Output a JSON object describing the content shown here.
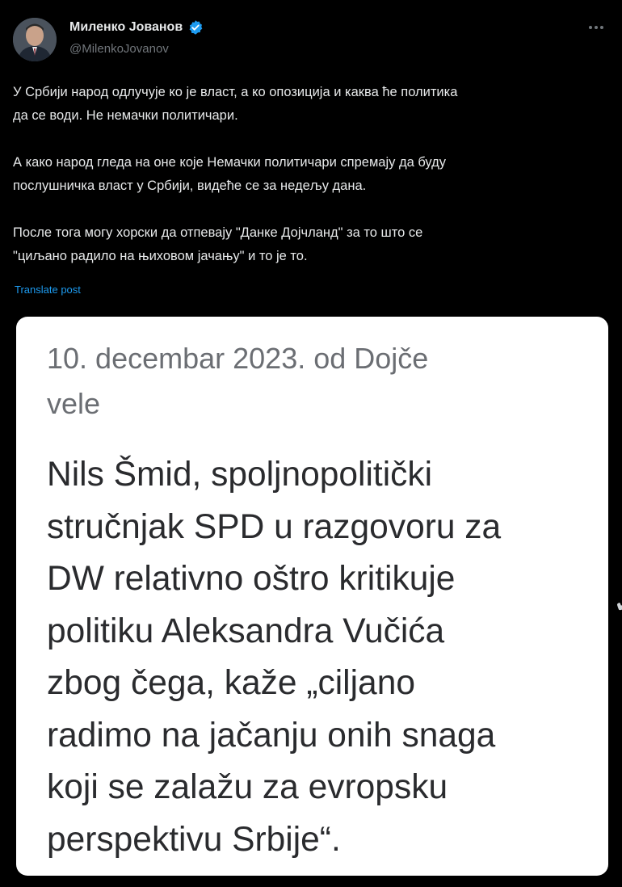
{
  "author": {
    "display_name": "Миленко Јованов",
    "handle": "@MilenkoJovanov",
    "verified": true
  },
  "tweet": {
    "paragraphs": [
      [
        "У Србији народ одлучује ко је власт, а ко опозиција и каква ће политика",
        "да се води. Не немачки политичари."
      ],
      [
        "А како народ гледа на оне које Немачки политичари спремају да буду",
        "послушничка власт у Србији, видеће се за недељу дана."
      ],
      [
        "После тога могу хорски да отпевају \"Данке Дојчланд\" за то што се",
        "\"циљано радило на њиховом јачању\" и то је то."
      ]
    ],
    "translate_label": "Translate post"
  },
  "card": {
    "date_lines": [
      "10. decembar 2023. od Dojče",
      "vele"
    ],
    "body_lines": [
      "Nils Šmid, spoljnopolitički",
      "stručnjak SPD u razgovoru za",
      "DW relativno oštro kritikuje",
      "politiku Aleksandra Vučića",
      "zbog čega, kaže „ciljano",
      "radimo na jačanju onih snaga",
      "koji se zalažu za evropsku",
      "perspektivu Srbije“."
    ]
  },
  "icons": {
    "verified": "verified-badge-icon",
    "more": "more-options-icon"
  },
  "colors": {
    "background": "#000000",
    "text": "#e7e9ea",
    "secondary": "#71767b",
    "link": "#1d9bf0",
    "verified": "#1d9bf0"
  }
}
